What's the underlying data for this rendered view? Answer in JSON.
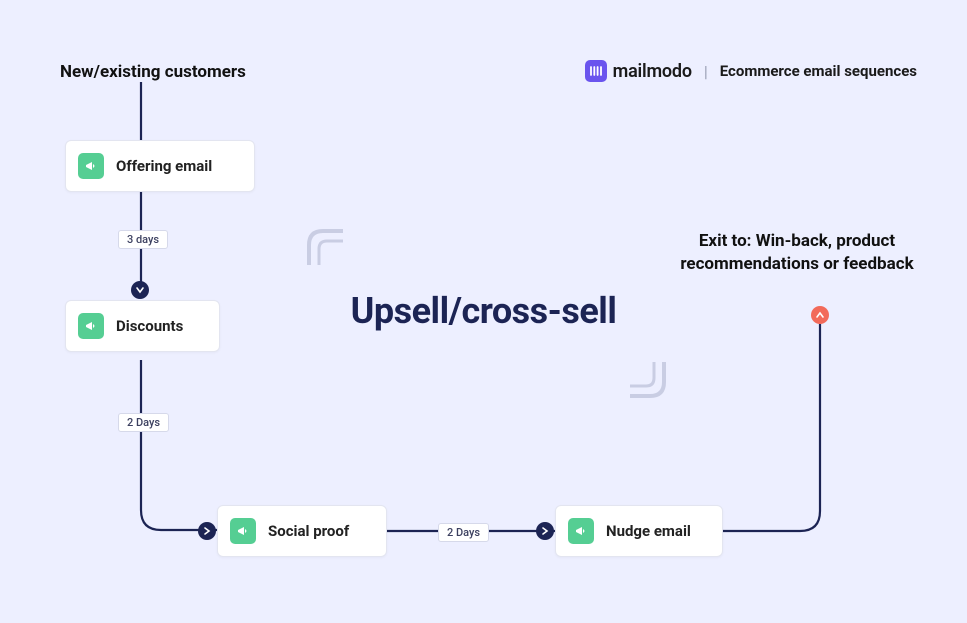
{
  "header": {
    "logo_text": "mailmodo",
    "subtitle": "Ecommerce email sequences"
  },
  "start_label": "New/existing customers",
  "center_title": "Upsell/cross-sell",
  "exit_label": "Exit to: Win-back, product recommendations or feedback",
  "nodes": {
    "offering": "Offering email",
    "discounts": "Discounts",
    "social_proof": "Social proof",
    "nudge": "Nudge email"
  },
  "delays": {
    "d1": "3 days",
    "d2": "2 Days",
    "d3": "2 Days"
  }
}
